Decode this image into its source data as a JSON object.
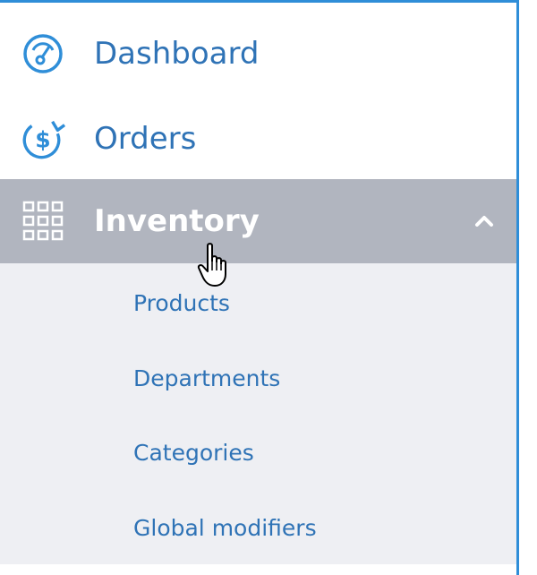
{
  "sidebar": {
    "items": [
      {
        "label": "Dashboard",
        "icon": "speedometer-icon"
      },
      {
        "label": "Orders",
        "icon": "dollar-refresh-icon"
      },
      {
        "label": "Inventory",
        "icon": "grid-icon",
        "expanded": true
      }
    ],
    "submenu": [
      {
        "label": "Products"
      },
      {
        "label": "Departments"
      },
      {
        "label": "Categories"
      },
      {
        "label": "Global modifiers"
      }
    ]
  },
  "colors": {
    "accent": "#2f8ed8",
    "link": "#2f73b6",
    "active_bg": "#b1b5bf",
    "submenu_bg": "#eeeff3"
  }
}
